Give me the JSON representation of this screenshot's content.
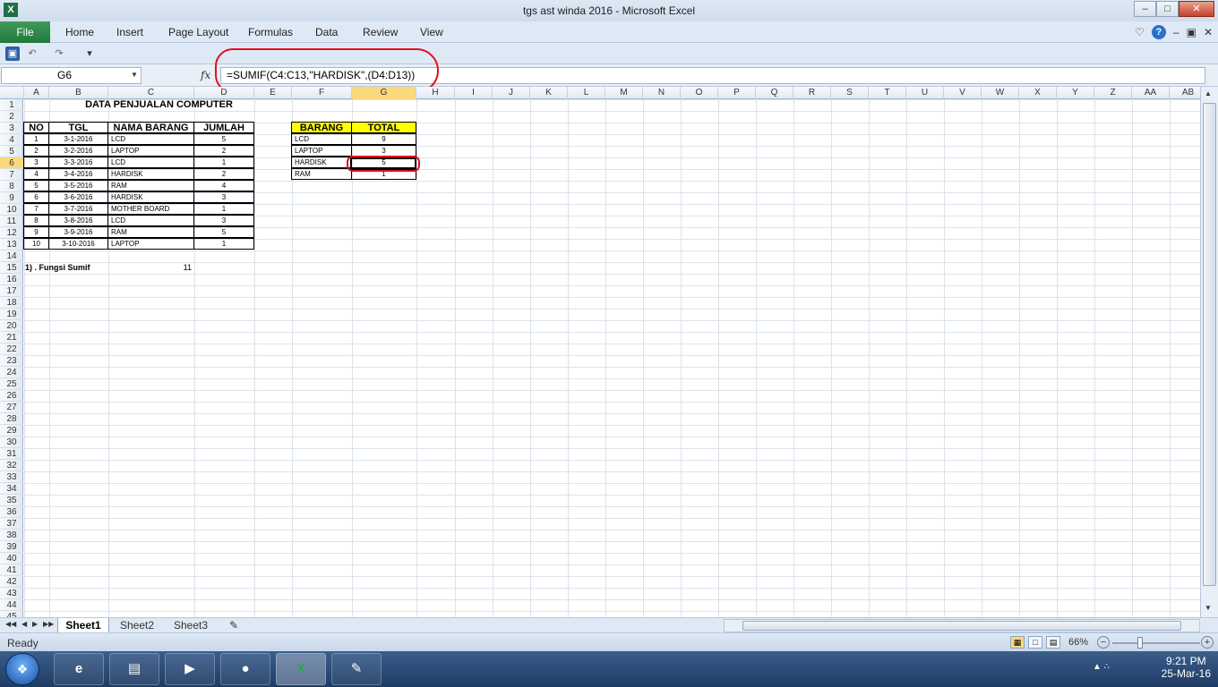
{
  "window": {
    "title": "tgs ast winda 2016  -  Microsoft Excel",
    "app_icon": "X",
    "controls": [
      "–",
      "□",
      "✕"
    ]
  },
  "ribbon": {
    "file_label": "File",
    "tabs": [
      "Home",
      "Insert",
      "Page Layout",
      "Formulas",
      "Data",
      "Review",
      "View"
    ],
    "right_icons": [
      "♡",
      "?",
      "–",
      "▣",
      "✕"
    ]
  },
  "formula_bar": {
    "name_box": "G6",
    "fx_label": "fx",
    "formula": "=SUMIF(C4:C13,\"HARDISK\",(D4:D13))"
  },
  "sheet": {
    "columns": [
      "A",
      "B",
      "C",
      "D",
      "E",
      "F",
      "G",
      "H",
      "I",
      "J",
      "K",
      "L",
      "M",
      "N",
      "O",
      "P",
      "Q",
      "R",
      "S",
      "T",
      "U",
      "V",
      "W",
      "X",
      "Y",
      "Z",
      "AA",
      "AB"
    ],
    "row_numbers": [
      "1",
      "2",
      "3",
      "4",
      "5",
      "6",
      "7",
      "8",
      "9",
      "10",
      "11",
      "12",
      "13",
      "14",
      "15",
      "16",
      "17",
      "18",
      "19",
      "20",
      "21",
      "22",
      "23",
      "24",
      "25",
      "26",
      "27",
      "28",
      "29",
      "30",
      "31",
      "32",
      "33",
      "34",
      "35",
      "36",
      "37",
      "38",
      "39",
      "40",
      "41",
      "42",
      "43",
      "44",
      "45"
    ],
    "title": "DATA PENJUALAN COMPUTER",
    "main_table": {
      "headers": [
        "NO",
        "TGL",
        "NAMA BARANG",
        "JUMLAH"
      ],
      "rows": [
        [
          "1",
          "3-1-2016",
          "LCD",
          "5"
        ],
        [
          "2",
          "3-2-2016",
          "LAPTOP",
          "2"
        ],
        [
          "3",
          "3-3-2016",
          "LCD",
          "1"
        ],
        [
          "4",
          "3-4-2016",
          "HARDISK",
          "2"
        ],
        [
          "5",
          "3-5-2016",
          "RAM",
          "4"
        ],
        [
          "6",
          "3-6-2016",
          "HARDISK",
          "3"
        ],
        [
          "7",
          "3-7-2016",
          "MOTHER BOARD",
          "1"
        ],
        [
          "8",
          "3-8-2016",
          "LCD",
          "3"
        ],
        [
          "9",
          "3-9-2016",
          "RAM",
          "5"
        ],
        [
          "10",
          "3-10-2016",
          "LAPTOP",
          "1"
        ]
      ]
    },
    "summary_table": {
      "headers": [
        "BARANG",
        "TOTAL"
      ],
      "rows": [
        [
          "LCD",
          "9"
        ],
        [
          "LAPTOP",
          "3"
        ],
        [
          "HARDISK",
          "5"
        ],
        [
          "RAM",
          "1"
        ]
      ]
    },
    "footer_label": "1) . Fungsi Sumif",
    "footer_value": "11",
    "header_fill": "#ffff00",
    "annotation_color": "#e0101a"
  },
  "sheet_tabs": [
    "Sheet1",
    "Sheet2",
    "Sheet3"
  ],
  "status": {
    "ready": "Ready",
    "zoom": "66%"
  },
  "taskbar": {
    "apps": [
      "e",
      "▤",
      "▶",
      "●",
      "X",
      "✎"
    ],
    "time": "9:21 PM",
    "date": "25-Mar-16"
  }
}
